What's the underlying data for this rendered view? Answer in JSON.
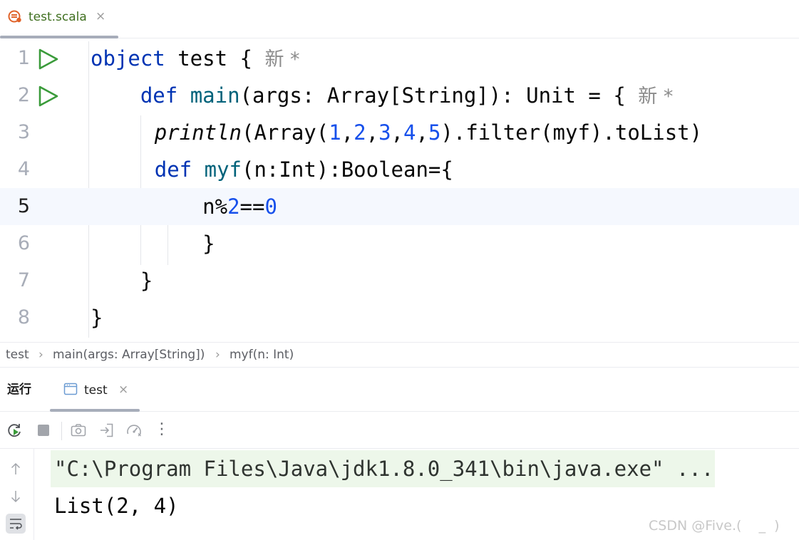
{
  "editor_tab": {
    "file_name": "test.scala",
    "close_glyph": "×",
    "icon": "scala-file-icon"
  },
  "editor": {
    "inlay_hint": "新 *",
    "lines": [
      {
        "number": "1",
        "has_run_gutter": true
      },
      {
        "number": "2",
        "has_run_gutter": true
      },
      {
        "number": "3",
        "has_run_gutter": false
      },
      {
        "number": "4",
        "has_run_gutter": false
      },
      {
        "number": "5",
        "has_run_gutter": false,
        "current": true
      },
      {
        "number": "6",
        "has_run_gutter": false
      },
      {
        "number": "7",
        "has_run_gutter": false
      },
      {
        "number": "8",
        "has_run_gutter": false
      }
    ],
    "tokens": {
      "l1": {
        "kw": "object",
        "name": " test ",
        "brace": "{"
      },
      "l2": {
        "indent": "    ",
        "kw": "def",
        "fn": "main",
        "rest": "(args: Array[String]): Unit = {"
      },
      "l3": {
        "indent": "      ",
        "fn": "println",
        "a": "(Array(",
        "n1": "1",
        "c1": ",",
        "n2": "2",
        "c2": ",",
        "n3": "3",
        "c3": ",",
        "n4": "4",
        "c4": ",",
        "n5": "5",
        "b": ").filter(myf).toList)"
      },
      "l4": {
        "indent": "      ",
        "kw": "def",
        "fn": "myf",
        "rest": "(n:Int):Boolean={"
      },
      "l5": {
        "indent": "         ",
        "a": "n%",
        "n1": "2",
        "b": "==",
        "n2": "0"
      },
      "l6": {
        "indent": "         ",
        "brace": "}"
      },
      "l7": {
        "indent": "    ",
        "brace": "}"
      },
      "l8": {
        "brace": "}"
      }
    }
  },
  "breadcrumbs": {
    "items": [
      "test",
      "main(args: Array[String])",
      "myf(n: Int)"
    ],
    "separator": "›"
  },
  "run_panel": {
    "title": "运行",
    "tab_label": "test",
    "close_glyph": "×",
    "toolbar_icons": [
      "rerun-icon",
      "stop-icon",
      "screenshot-icon",
      "exit-icon",
      "profiler-icon",
      "more-icon"
    ],
    "more_glyph": "⋮"
  },
  "console": {
    "command_line": "\"C:\\Program Files\\Java\\jdk1.8.0_341\\bin\\java.exe\" ...",
    "output_line": "List(2, 4)",
    "gutter_icons": [
      "scroll-up-icon",
      "scroll-down-icon",
      "soft-wrap-icon"
    ]
  },
  "watermark": "CSDN @Five.(    _  )",
  "colors": {
    "keyword": "#0033b3",
    "function": "#00627a",
    "number": "#1750eb",
    "run_green": "#3a9b3a",
    "current_line": "#f5f8fe",
    "console_cmd_bg": "#edf7ea"
  }
}
